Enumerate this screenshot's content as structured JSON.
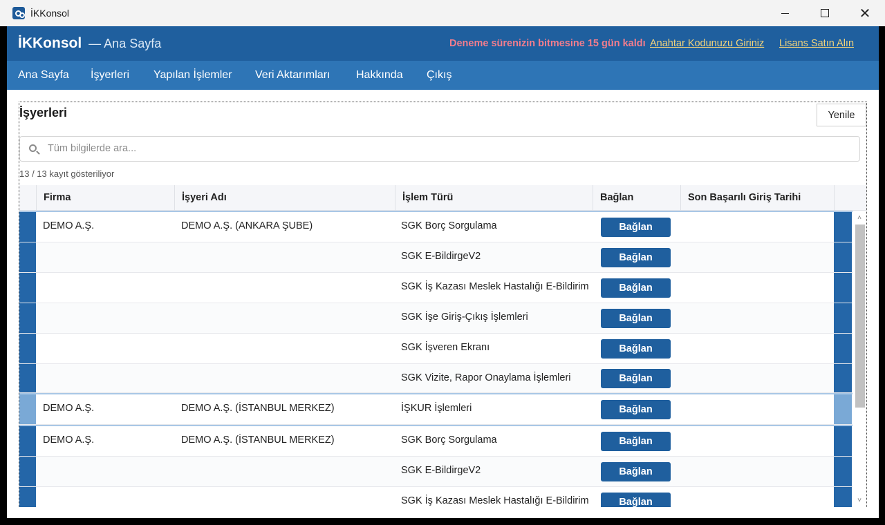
{
  "window": {
    "title": "İKKonsol"
  },
  "header": {
    "brand": "İKKonsol",
    "subtitle": "— Ana Sayfa",
    "trial_notice": "Deneme sürenizin bitmesine 15 gün kaldı",
    "key_link": "Anahtar Kodunuzu Giriniz",
    "license_link": "Lisans Satın Alın"
  },
  "nav": [
    "Ana Sayfa",
    "İşyerleri",
    "Yapılan İşlemler",
    "Veri Aktarımları",
    "Hakkında",
    "Çıkış"
  ],
  "panel": {
    "title": "İşyerleri",
    "refresh_label": "Yenile",
    "search_placeholder": "Tüm bilgilerde ara...",
    "count_text": "13 / 13 kayıt gösteriliyor"
  },
  "grid": {
    "columns": [
      "Firma",
      "İşyeri Adı",
      "İşlem Türü",
      "Bağlan",
      "Son Başarılı Giriş Tarihi"
    ],
    "connect_label": "Bağlan",
    "rows": [
      {
        "firma": "DEMO A.Ş.",
        "isyeri": "DEMO A.Ş. (ANKARA ŞUBE)",
        "islem": "SGK Borç Sorgulama",
        "son": ""
      },
      {
        "firma": "",
        "isyeri": "",
        "islem": "SGK E-BildirgeV2",
        "son": ""
      },
      {
        "firma": "",
        "isyeri": "",
        "islem": "SGK İş Kazası Meslek Hastalığı E-Bildirim",
        "son": ""
      },
      {
        "firma": "",
        "isyeri": "",
        "islem": "SGK İşe Giriş-Çıkış İşlemleri",
        "son": ""
      },
      {
        "firma": "",
        "isyeri": "",
        "islem": "SGK İşveren Ekranı",
        "son": ""
      },
      {
        "firma": "",
        "isyeri": "",
        "islem": "SGK Vizite, Rapor Onaylama İşlemleri",
        "son": ""
      },
      {
        "firma": "DEMO A.Ş.",
        "isyeri": "DEMO A.Ş. (İSTANBUL MERKEZ)",
        "islem": "İŞKUR İşlemleri",
        "son": ""
      },
      {
        "firma": "DEMO A.Ş.",
        "isyeri": "DEMO A.Ş. (İSTANBUL MERKEZ)",
        "islem": "SGK Borç Sorgulama",
        "son": ""
      },
      {
        "firma": "",
        "isyeri": "",
        "islem": "SGK E-BildirgeV2",
        "son": ""
      },
      {
        "firma": "",
        "isyeri": "",
        "islem": "SGK İş Kazası Meslek Hastalığı E-Bildirim",
        "son": ""
      }
    ]
  },
  "colors": {
    "header": "#1f5f9e",
    "nav": "#2e75b6",
    "trial": "#f27d8d",
    "link": "#f3d37a",
    "button": "#1f5f9e"
  }
}
